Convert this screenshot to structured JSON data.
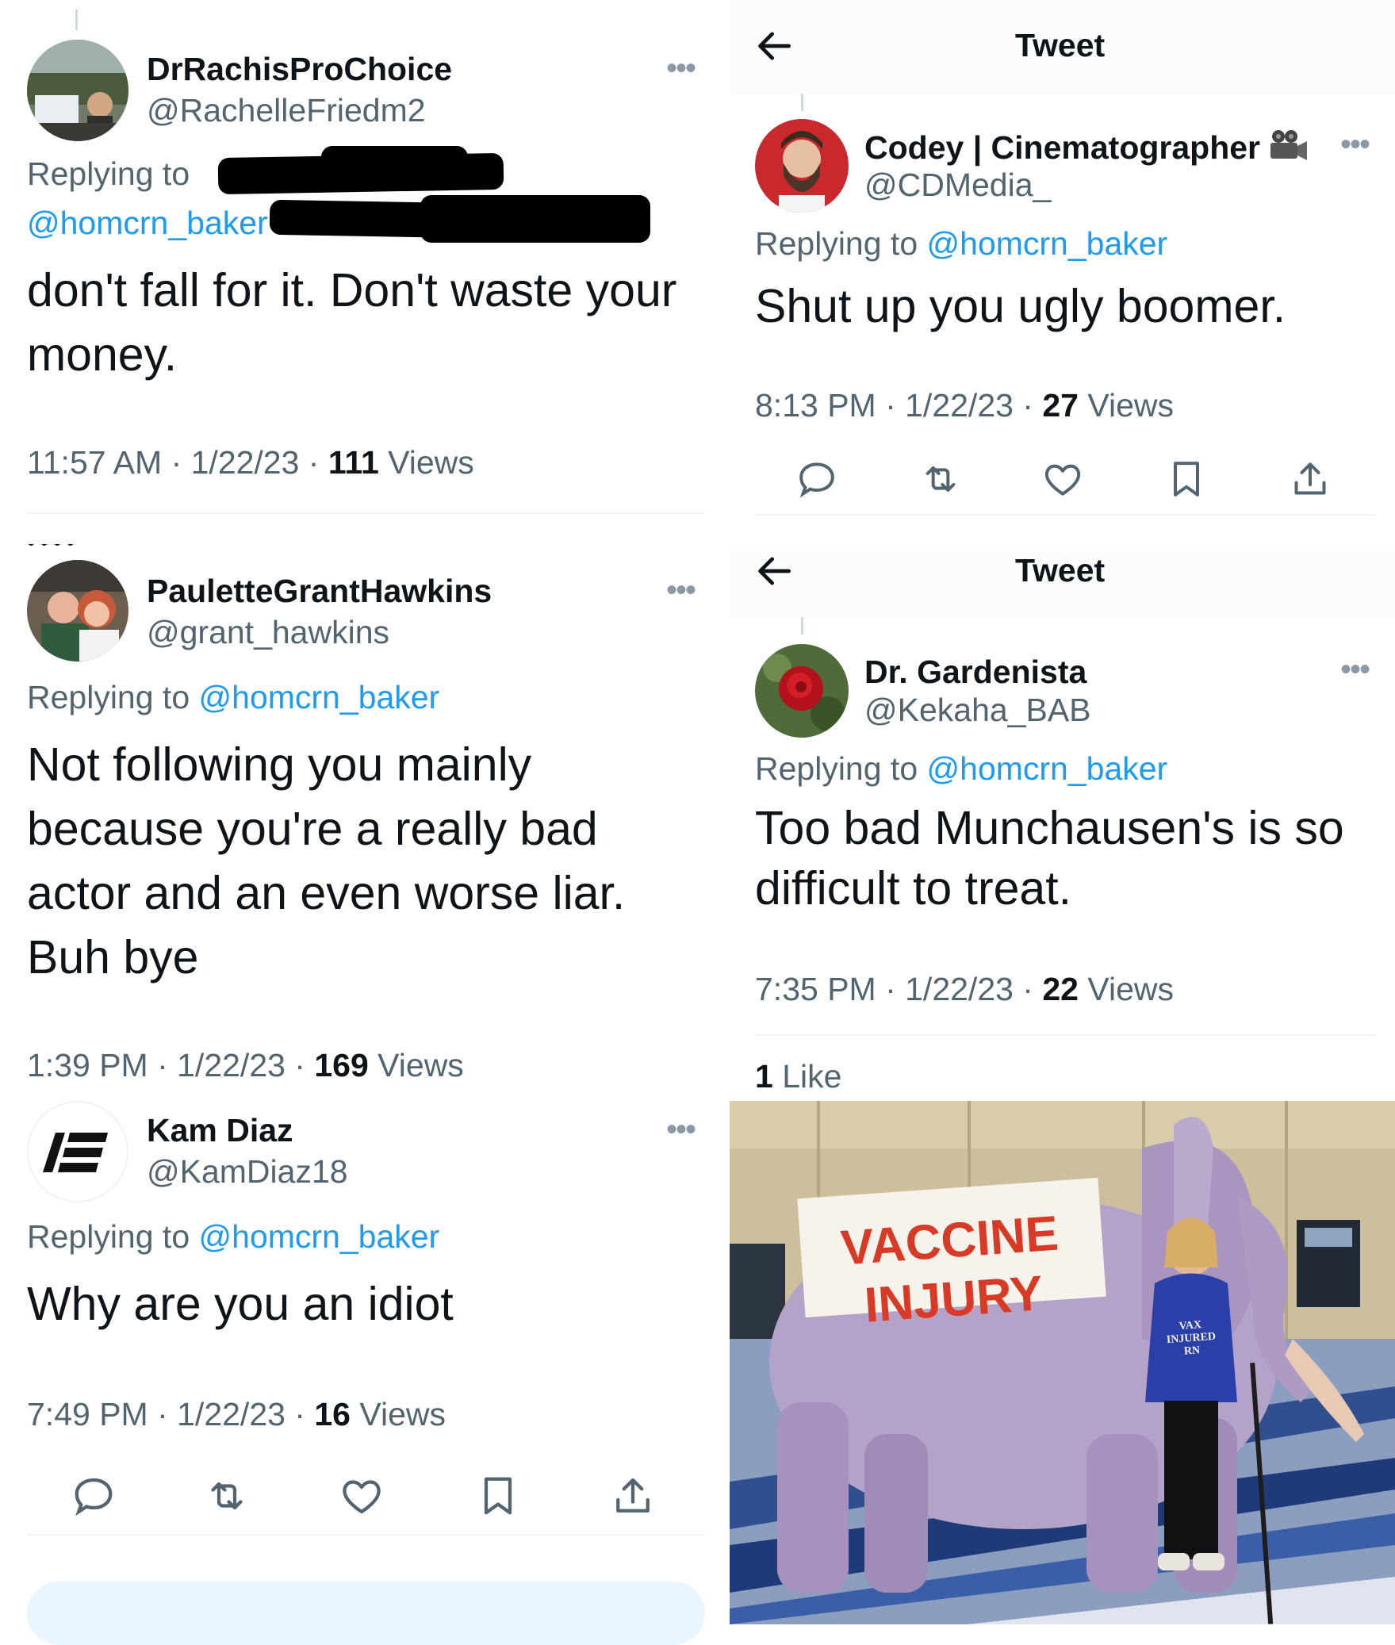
{
  "tweet1": {
    "name": "DrRachisProChoice",
    "handle": "@RachelleFriedm2",
    "replying_prefix": "Replying to ",
    "replying_link": "@homcrn_baker",
    "text": "don't fall for it.  Don't waste your money.",
    "time": "11:57 AM · 1/22/23 · ",
    "views_count": "111",
    "views_label": " Views"
  },
  "tweet2": {
    "name": "PauletteGrantHawkins",
    "handle": "@grant_hawkins",
    "replying_prefix": "Replying to ",
    "replying_link": "@homcrn_baker",
    "text": "Not following you mainly because you're a really bad actor and an even worse liar. Buh bye",
    "time": "1:39 PM · 1/22/23 · ",
    "views_count": "169",
    "views_label": " Views"
  },
  "tweet3": {
    "name": "Kam Diaz",
    "handle": "@KamDiaz18",
    "replying_prefix": "Replying to ",
    "replying_link": "@homcrn_baker",
    "text": "Why are you an idiot",
    "time": "7:49 PM · 1/22/23 · ",
    "views_count": "16",
    "views_label": " Views"
  },
  "tweet4": {
    "header_title": "Tweet",
    "name": "Codey | Cinematographer",
    "name_emoji": "movie-camera-icon",
    "handle": "@CDMedia_",
    "replying_prefix": "Replying to ",
    "replying_link": "@homcrn_baker",
    "text": "Shut up you ugly boomer.",
    "time": "8:13 PM · 1/22/23 · ",
    "views_count": "27",
    "views_label": " Views"
  },
  "tweet5": {
    "header_title": "Tweet",
    "name": "Dr. Gardenista",
    "handle": "@Kekaha_BAB",
    "replying_prefix": "Replying to ",
    "replying_link": "@homcrn_baker",
    "text": "Too bad Munchausen's is so difficult to treat.",
    "time": "7:35 PM · 1/22/23 · ",
    "views_count": "22",
    "views_label": " Views",
    "likes_count": "1",
    "likes_label": " Like"
  },
  "photo": {
    "banner_line1": "VACCINE",
    "banner_line2": "INJURY",
    "shirt_line1": "VAX INJURED",
    "shirt_line2": "RN"
  },
  "icons": [
    "more-icon",
    "back-arrow-icon",
    "reply-icon",
    "retweet-icon",
    "like-icon",
    "bookmark-icon",
    "share-icon"
  ],
  "colors": {
    "link": "#1d9bf0",
    "secondary_text": "#536471",
    "primary_text": "#0f1419",
    "banner_red": "#d83a26",
    "shirt_blue": "#2a3fa8"
  }
}
